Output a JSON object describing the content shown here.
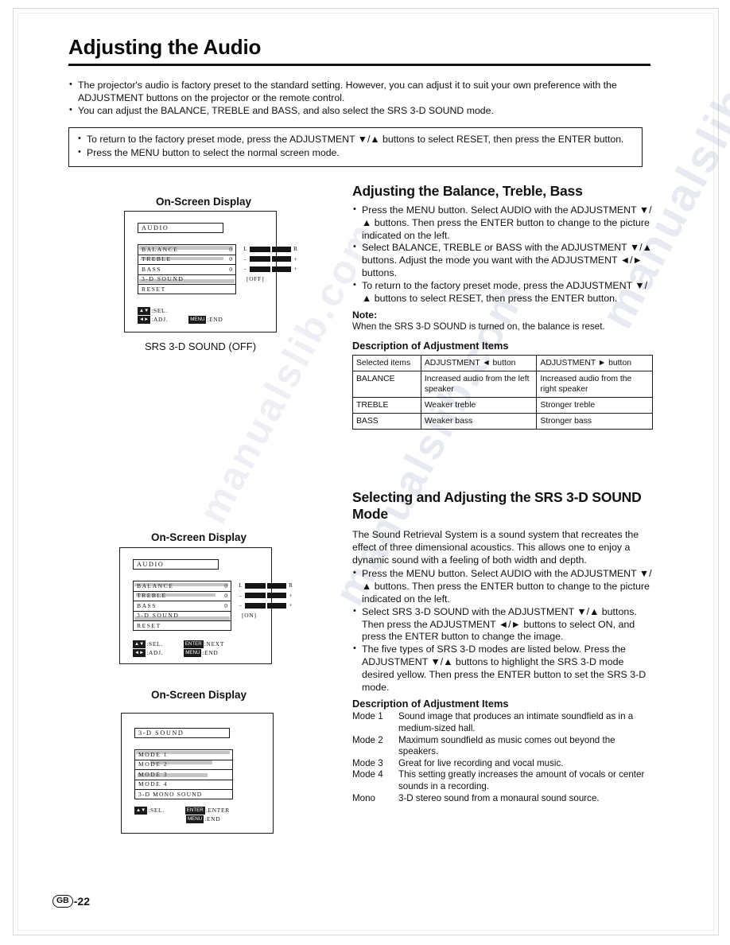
{
  "page": {
    "title": "Adjusting the Audio",
    "footer_locale": "GB",
    "footer_page": "-22",
    "watermark": "manualslib.com"
  },
  "intro": {
    "bullets": [
      "The projector's audio is factory preset to the standard setting. However, you can adjust it to suit your own preference with the ADJUSTMENT buttons on the projector or the remote control.",
      "You can adjust the BALANCE, TREBLE and BASS, and also select the SRS 3-D SOUND mode."
    ]
  },
  "note_box": {
    "bullets": [
      "To return to the factory preset mode, press the ADJUSTMENT ▼/▲ buttons to select RESET, then press the ENTER button.",
      "Press the MENU button to select the normal screen mode."
    ]
  },
  "osd1": {
    "caption": "On-Screen Display",
    "subcaption": "SRS 3-D SOUND (OFF)",
    "title": "AUDIO",
    "rows": [
      {
        "label": "BALANCE",
        "value": "0"
      },
      {
        "label": "TREBLE",
        "value": "0"
      },
      {
        "label": "BASS",
        "value": "0"
      },
      {
        "label": "3-D  SOUND",
        "value": ""
      },
      {
        "label": "RESET",
        "value": ""
      }
    ],
    "gauges": [
      {
        "left": "L",
        "right": "R",
        "type": "bar"
      },
      {
        "left": "-",
        "right": "+",
        "type": "bar"
      },
      {
        "left": "-",
        "right": "+",
        "type": "bar"
      },
      {
        "text": "[OFF]",
        "type": "text"
      }
    ],
    "legend": [
      {
        "key": "▲▼",
        "label": ":SEL."
      },
      {
        "key": "◄►",
        "label": ":ADJ."
      },
      {
        "key": "MENU",
        "label": ":END"
      }
    ]
  },
  "osd2": {
    "caption": "On-Screen Display",
    "title": "AUDIO",
    "rows": [
      {
        "label": "BALANCE",
        "value": "0"
      },
      {
        "label": "TREBLE",
        "value": "0"
      },
      {
        "label": "BASS",
        "value": "0"
      },
      {
        "label": "3-D  SOUND",
        "value": ""
      },
      {
        "label": "RESET",
        "value": ""
      }
    ],
    "gauges": [
      {
        "left": "L",
        "right": "R",
        "type": "bar"
      },
      {
        "left": "-",
        "right": "+",
        "type": "bar"
      },
      {
        "left": "-",
        "right": "+",
        "type": "bar"
      },
      {
        "text": "[ON]",
        "type": "text"
      }
    ],
    "legend": [
      {
        "key": "▲▼",
        "label": ":SEL."
      },
      {
        "key": "ENTER",
        "label": ":NEXT"
      },
      {
        "key": "◄►",
        "label": ":ADJ."
      },
      {
        "key": "MENU",
        "label": ":END"
      }
    ]
  },
  "osd3": {
    "caption": "On-Screen Display",
    "title": "3-D  SOUND",
    "rows": [
      {
        "label": "MODE  1",
        "value": ""
      },
      {
        "label": "MODE  2",
        "value": ""
      },
      {
        "label": "MODE  3",
        "value": ""
      },
      {
        "label": "MODE  4",
        "value": ""
      },
      {
        "label": "3-D  MONO  SOUND",
        "value": ""
      }
    ],
    "legend": [
      {
        "key": "▲▼",
        "label": ":SEL."
      },
      {
        "key": "ENTER",
        "label": ":ENTER"
      },
      {
        "key": "MENU",
        "label": ":END"
      }
    ]
  },
  "balance_section": {
    "heading": "Adjusting the Balance, Treble, Bass",
    "bullets": [
      "Press the MENU button. Select AUDIO with the ADJUSTMENT ▼/▲ buttons. Then press the ENTER button to change to the picture indicated on the left.",
      "Select BALANCE, TREBLE or BASS with the ADJUSTMENT ▼/▲ buttons. Adjust the mode you want with the ADJUSTMENT ◄/► buttons.",
      "To return to the factory preset mode, press the ADJUSTMENT ▼/▲ buttons to select RESET, then press the ENTER button."
    ],
    "note_label": "Note:",
    "note_text": "When the SRS 3-D SOUND is turned on, the balance is reset.",
    "table_heading": "Description of Adjustment Items"
  },
  "adjustment_table": {
    "headers": [
      "Selected items",
      "ADJUSTMENT ◄ button",
      "ADJUSTMENT ► button"
    ],
    "rows": [
      [
        "BALANCE",
        "Increased audio from the left speaker",
        "Increased audio from the right speaker"
      ],
      [
        "TREBLE",
        "Weaker treble",
        "Stronger treble"
      ],
      [
        "BASS",
        "Weaker bass",
        "Stronger bass"
      ]
    ]
  },
  "srs_section": {
    "heading": "Selecting and Adjusting the SRS 3-D SOUND Mode",
    "intro": "The Sound Retrieval System is a sound system that recreates the effect of three dimensional acoustics. This allows one to enjoy a dynamic sound with a feeling of both width and depth.",
    "bullets": [
      "Press the MENU button. Select AUDIO with the ADJUSTMENT ▼/▲ buttons. Then press the ENTER button to change to the picture indicated on the left.",
      "Select SRS 3-D SOUND with the ADJUSTMENT ▼/▲ buttons. Then press the ADJUSTMENT ◄/► buttons to select ON, and press the ENTER button to change the image.",
      "The five types of SRS 3-D modes are listed below. Press the ADJUSTMENT ▼/▲ buttons to highlight the SRS 3-D mode desired yellow. Then press the ENTER button to set the SRS 3-D mode."
    ],
    "desc_heading": "Description of Adjustment Items",
    "modes": [
      {
        "name": "Mode 1",
        "desc": "Sound image that produces an intimate soundfield as in a medium-sized hall."
      },
      {
        "name": "Mode 2",
        "desc": "Maximum soundfield as music comes out beyond the speakers."
      },
      {
        "name": "Mode 3",
        "desc": "Great for live recording and vocal music."
      },
      {
        "name": "Mode 4",
        "desc": "This setting greatly increases the amount of vocals or center sounds in a recording."
      },
      {
        "name": "Mono",
        "desc": "3-D stereo sound from a monaural sound source."
      }
    ]
  }
}
